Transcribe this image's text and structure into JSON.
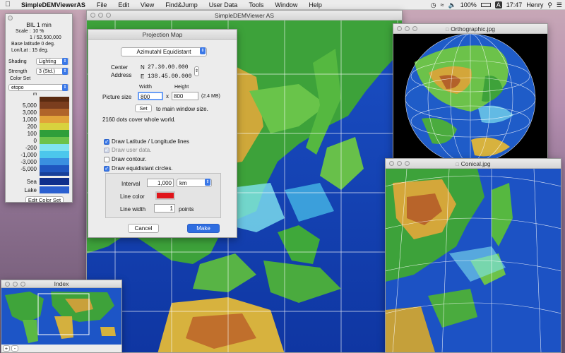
{
  "menubar": {
    "apple": "",
    "app_name": "SimpleDEMViewerAS",
    "items": [
      "File",
      "Edit",
      "View",
      "Find&Jump",
      "User Data",
      "Tools",
      "Window",
      "Help"
    ],
    "battery": "100%",
    "input_source": "A",
    "clock": "17:47",
    "user": "Henry"
  },
  "main_window": {
    "title": "SimpleDEMViewer AS"
  },
  "palette": {
    "title": "BIL 1 min",
    "scale_label": "Scale :",
    "scale_pct": "10 %",
    "scale_ratio": "1 / 52,500,000",
    "base_latitude": "Base latitude 0 deg.",
    "lonlat": "Lon/Lat : 15 deg.",
    "shading_label": "Shading",
    "shading_value": "Lighting",
    "strength_label": "Strength",
    "strength_value": "3 (Std.)",
    "colorset_label": "Color Set",
    "colorset_value": "etopo",
    "unit": "m",
    "legend": [
      {
        "label": "5,000",
        "color": "#7a3d1e"
      },
      {
        "label": "3,000",
        "color": "#b0642a"
      },
      {
        "label": "1,000",
        "color": "#e2a33a"
      },
      {
        "label": "200",
        "color": "#d8d23e"
      },
      {
        "label": "100",
        "color": "#2f9e3a"
      },
      {
        "label": "0",
        "color": "#6cc24a"
      },
      {
        "label": "-200",
        "color": "#7fe3f0"
      },
      {
        "label": "-1,000",
        "color": "#4cc7ec"
      },
      {
        "label": "-3,000",
        "color": "#3a8fe0"
      },
      {
        "label": "-5,000",
        "color": "#1f56c0"
      }
    ],
    "sea_label": "Sea",
    "sea_color": "#0f2f8c",
    "lake_label": "Lake",
    "lake_color": "#2a5fd0",
    "edit_button": "Edit Color Set"
  },
  "projection": {
    "title": "Projection Map",
    "method": "Azimutahl Equidistant",
    "center_label_1": "Center",
    "center_label_2": "Address",
    "lat_prefix": "N",
    "lat_value": "27.30.00.000",
    "lon_prefix": "E",
    "lon_value": "138.45.00.000",
    "picture_size_label": "Picture size",
    "width_label": "Width",
    "height_label": "Height",
    "width_value": "800",
    "height_value": "800",
    "times": "x",
    "size_mb": "(2.4 MB)",
    "set_button": "Set",
    "set_text": "to main window size.",
    "dots_text": "2160 dots cover whole world.",
    "draw_latlon": "Draw Latitude / Longitude lines",
    "draw_user": "Draw user data.",
    "draw_contour": "Draw contour.",
    "draw_circles": "Draw equidistant circles.",
    "interval_label": "Interval",
    "interval_value": "1,000",
    "interval_unit": "km",
    "line_color_label": "Line color",
    "line_color": "#e0141a",
    "line_width_label": "Line width",
    "line_width_value": "1",
    "points_label": "points",
    "cancel_button": "Cancel",
    "make_button": "Make"
  },
  "ortho_window": {
    "title": "Orthographic.jpg"
  },
  "conical_window": {
    "title": "Conical.jpg"
  },
  "index_window": {
    "title": "Index",
    "plus": "+",
    "minus": "-"
  }
}
